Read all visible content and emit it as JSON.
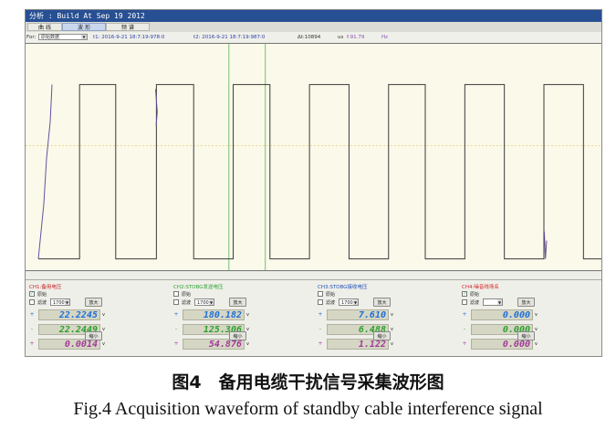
{
  "window": {
    "title": "分析 : Build At Sep 19 2012"
  },
  "tabs": [
    {
      "label": "曲 线",
      "active": false
    },
    {
      "label": "波 形",
      "active": true
    },
    {
      "label": "频 谱",
      "active": false
    }
  ],
  "toolbar": {
    "for_label": "For:",
    "select_value": "原始数据",
    "t1": "t1: 2016-9-21 18:7:19:978:0",
    "t2": "t2: 2016-9-21 18:7:19:987:0",
    "dt": "Δt:10894",
    "us": "us",
    "freq": "f:91.79",
    "hz": "Hz"
  },
  "plot": {
    "background": "#fbf9ea",
    "trace_color": "#3a3a3a",
    "cursor_color": "#74c276",
    "high_level": 0.82,
    "low_level": 0.05,
    "transitions_fraction": [
      0.0,
      0.073,
      0.137,
      0.209,
      0.275,
      0.345,
      0.41,
      0.48,
      0.55,
      0.62,
      0.685,
      0.755,
      0.825,
      0.895,
      0.965,
      1.0
    ]
  },
  "channels": [
    {
      "title": "CH1:备用电压",
      "title_color": "#c02323",
      "raw_label": "原始",
      "raw_checked": true,
      "filter_label": "滤波",
      "filter_checked": false,
      "filter_value": "1700",
      "zoom_in": "放大",
      "zoom_out": "缩小",
      "readouts": [
        {
          "sign": "+",
          "value": "22.2245",
          "unit": "v",
          "color": "#1e6fd9"
        },
        {
          "sign": "-",
          "value": "22.2449",
          "unit": "v",
          "color": "#2ca02c"
        },
        {
          "sign": "+",
          "value": "0.0014",
          "unit": "v",
          "color": "#a23a9a"
        }
      ]
    },
    {
      "title": "CH2:STOBG发送电压",
      "title_color": "#2ca02c",
      "raw_label": "原始",
      "raw_checked": false,
      "filter_label": "滤波",
      "filter_checked": false,
      "filter_value": "1700",
      "zoom_in": "放大",
      "zoom_out": "缩小",
      "readouts": [
        {
          "sign": "+",
          "value": "180.182",
          "unit": "v",
          "color": "#1e6fd9"
        },
        {
          "sign": "-",
          "value": "125.306",
          "unit": "v",
          "color": "#2ca02c"
        },
        {
          "sign": "+",
          "value": "54.876",
          "unit": "v",
          "color": "#a23a9a"
        }
      ]
    },
    {
      "title": "CH3:STOBG接收电压",
      "title_color": "#1e4fb5",
      "raw_label": "原始",
      "raw_checked": false,
      "filter_label": "滤波",
      "filter_checked": false,
      "filter_value": "1700",
      "zoom_in": "放大",
      "zoom_out": "缩小",
      "readouts": [
        {
          "sign": "+",
          "value": "7.610",
          "unit": "v",
          "color": "#1e6fd9"
        },
        {
          "sign": "-",
          "value": "6.488",
          "unit": "v",
          "color": "#2ca02c"
        },
        {
          "sign": "+",
          "value": "1.122",
          "unit": "v",
          "color": "#a23a9a"
        }
      ]
    },
    {
      "title": "CH4:噪音线场名",
      "title_color": "#d62728",
      "raw_label": "原始",
      "raw_checked": true,
      "filter_label": "滤波",
      "filter_checked": false,
      "filter_value": "",
      "zoom_in": "放大",
      "zoom_out": "缩小",
      "readouts": [
        {
          "sign": "+",
          "value": "0.000",
          "unit": "v",
          "color": "#1e6fd9"
        },
        {
          "sign": "-",
          "value": "0.000",
          "unit": "v",
          "color": "#2ca02c"
        },
        {
          "sign": "+",
          "value": "0.000",
          "unit": "v",
          "color": "#a23a9a"
        }
      ]
    }
  ],
  "caption": {
    "cn": "图4　备用电缆干扰信号采集波形图",
    "en": "Fig.4    Acquisition waveform of standby cable interference signal"
  }
}
